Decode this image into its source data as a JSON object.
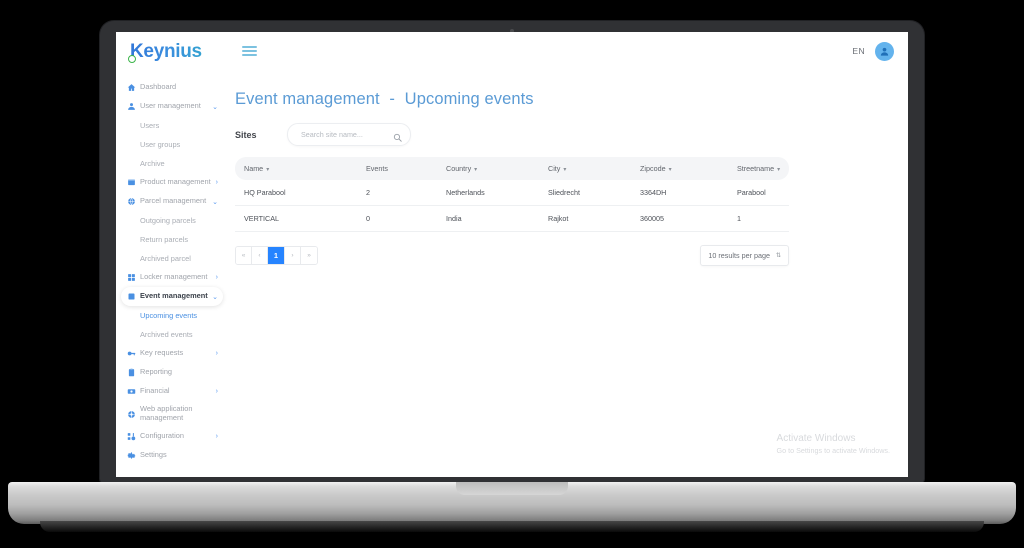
{
  "brand": {
    "name": "Keynius",
    "accent": "#3a8ede",
    "dot_color": "#3cb54a"
  },
  "topbar": {
    "menu_icon": "hamburger-icon",
    "language": "EN",
    "avatar_icon": "user-avatar-icon"
  },
  "sidebar": {
    "items": [
      {
        "label": "Dashboard",
        "icon": "home-icon",
        "caret": "",
        "level": "top",
        "state": ""
      },
      {
        "label": "User management",
        "icon": "user-icon",
        "caret": "⌄",
        "level": "top",
        "state": "expanded"
      },
      {
        "label": "Users",
        "icon": "",
        "caret": "",
        "level": "sub",
        "state": ""
      },
      {
        "label": "User groups",
        "icon": "",
        "caret": "",
        "level": "sub",
        "state": ""
      },
      {
        "label": "Archive",
        "icon": "",
        "caret": "",
        "level": "sub",
        "state": ""
      },
      {
        "label": "Product management",
        "icon": "box-icon",
        "caret": "›",
        "level": "top",
        "state": ""
      },
      {
        "label": "Parcel management",
        "icon": "globe-icon",
        "caret": "⌄",
        "level": "top",
        "state": "expanded"
      },
      {
        "label": "Outgoing parcels",
        "icon": "",
        "caret": "",
        "level": "sub",
        "state": ""
      },
      {
        "label": "Return parcels",
        "icon": "",
        "caret": "",
        "level": "sub",
        "state": ""
      },
      {
        "label": "Archived parcel",
        "icon": "",
        "caret": "",
        "level": "sub",
        "state": ""
      },
      {
        "label": "Locker management",
        "icon": "grid-icon",
        "caret": "›",
        "level": "top",
        "state": ""
      },
      {
        "label": "Event management",
        "icon": "square-icon",
        "caret": "⌄",
        "level": "top",
        "state": "active"
      },
      {
        "label": "Upcoming events",
        "icon": "",
        "caret": "",
        "level": "sub",
        "state": "selected"
      },
      {
        "label": "Archived events",
        "icon": "",
        "caret": "",
        "level": "sub",
        "state": ""
      },
      {
        "label": "Key requests",
        "icon": "key-icon",
        "caret": "›",
        "level": "top",
        "state": ""
      },
      {
        "label": "Reporting",
        "icon": "clipboard-icon",
        "caret": "",
        "level": "top",
        "state": ""
      },
      {
        "label": "Financial",
        "icon": "money-icon",
        "caret": "›",
        "level": "top",
        "state": ""
      },
      {
        "label": "Web application management",
        "icon": "network-icon",
        "caret": "",
        "level": "top",
        "state": "twoline"
      },
      {
        "label": "Configuration",
        "icon": "settings-blocks-icon",
        "caret": "›",
        "level": "top",
        "state": ""
      },
      {
        "label": "Settings",
        "icon": "gear-icon",
        "caret": "",
        "level": "top",
        "state": ""
      }
    ]
  },
  "page": {
    "title_primary": "Event management",
    "title_separator": "-",
    "title_secondary": "Upcoming events"
  },
  "filter": {
    "label": "Sites",
    "search_value": "",
    "search_placeholder": "Search site name...",
    "search_icon": "search-icon"
  },
  "table": {
    "columns": [
      {
        "label": "Name",
        "sortable": true
      },
      {
        "label": "Events",
        "sortable": false
      },
      {
        "label": "Country",
        "sortable": true
      },
      {
        "label": "City",
        "sortable": true
      },
      {
        "label": "Zipcode",
        "sortable": true
      },
      {
        "label": "Streetname",
        "sortable": true
      }
    ],
    "sort_caret": "▾",
    "rows": [
      {
        "name": "HQ Parabool",
        "events": "2",
        "country": "Netherlands",
        "city": "Sliedrecht",
        "zipcode": "3364DH",
        "streetname": "Parabool"
      },
      {
        "name": "VERTICAL",
        "events": "0",
        "country": "India",
        "city": "Rajkot",
        "zipcode": "360005",
        "streetname": "1"
      }
    ]
  },
  "pagination": {
    "first": "«",
    "prev": "‹",
    "current_page": "1",
    "next": "›",
    "last": "»",
    "per_page_label": "10 results per page",
    "per_page_arrows": "⇅"
  },
  "watermark": {
    "title": "Activate Windows",
    "subtitle": "Go to Settings to activate Windows."
  }
}
